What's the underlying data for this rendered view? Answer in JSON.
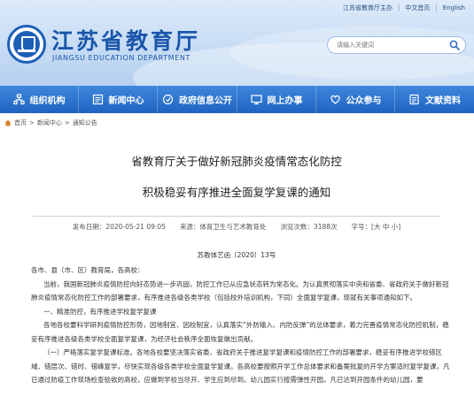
{
  "header": {
    "toplinks": [
      "江苏省教育厅主办",
      "中文首页",
      "English"
    ],
    "site_title": "江苏省教育厅",
    "site_subtitle": "JIANGSU EDUCATION DEPARTMENT",
    "search_placeholder": "请输入关键词"
  },
  "nav": {
    "items": [
      {
        "label": "组织机构",
        "icon": "org-icon"
      },
      {
        "label": "新闻中心",
        "icon": "news-icon"
      },
      {
        "label": "政府信息公开",
        "icon": "info-icon"
      },
      {
        "label": "网上办事",
        "icon": "online-service-icon"
      },
      {
        "label": "公众参与",
        "icon": "heart-icon"
      },
      {
        "label": "文献资料",
        "icon": "document-icon"
      }
    ]
  },
  "breadcrumb": {
    "items": [
      "首页",
      "新闻中心",
      "通知公告"
    ],
    "separator": ">"
  },
  "article": {
    "title_line1": "省教育厅关于做好新冠肺炎疫情常态化防控",
    "title_line2": "积极稳妥有序推进全面复学复课的通知",
    "publish_time": "发布日期：2020-05-21 09:05",
    "source": "来源：体育卫生与艺术教育处",
    "views": "浏览次数：3188次",
    "font_size_label": "字号：[大 中 小]",
    "doc_number": "苏教体艺函〔2020〕13号",
    "salutation": "各市、县（市、区）教育局，各高校：",
    "paragraphs": [
      "当前，我国新冠肺炎疫情防控向好态势进一步巩固，防控工作已从应急状态转为常态化。为认真贯彻落实中央和省委、省政府关于做好新冠肺炎疫情常态化防控工作的部署要求，有序推进各级各类学校（包括校外培训机构，下同）全面复学复课，现就有关事项通知如下。",
      "一、精准防控，有序推进学校复学复课",
      "各地各校要科学研判疫情防控形势，因地制宜、因校制宜，认真落实“外防输入、内防反弹”的总体要求，着力完善疫情常态化防控机制，稳妥有序推进各级各类学校全面复学复课，为经济社会秩序全面恢复做出贡献。",
      "（一）严格落实复学复课标准。各地各校要坚决落实省委、省政府关于推进复学复课和疫情防控工作的部署要求，稳妥有序推进学校错区域、错层次、错时、错峰复学，尽快实现各级各类学校全面复学复课。各高校要按照开学工作总体要求和备案批复的开学方案适时复学复课，凡已通过防疫工作现场检查验收的高校，应做到学校当尽开、学生应到尽到。幼儿园实行按需弹性开园，凡已达到开园条件的幼儿园，要"
    ]
  }
}
